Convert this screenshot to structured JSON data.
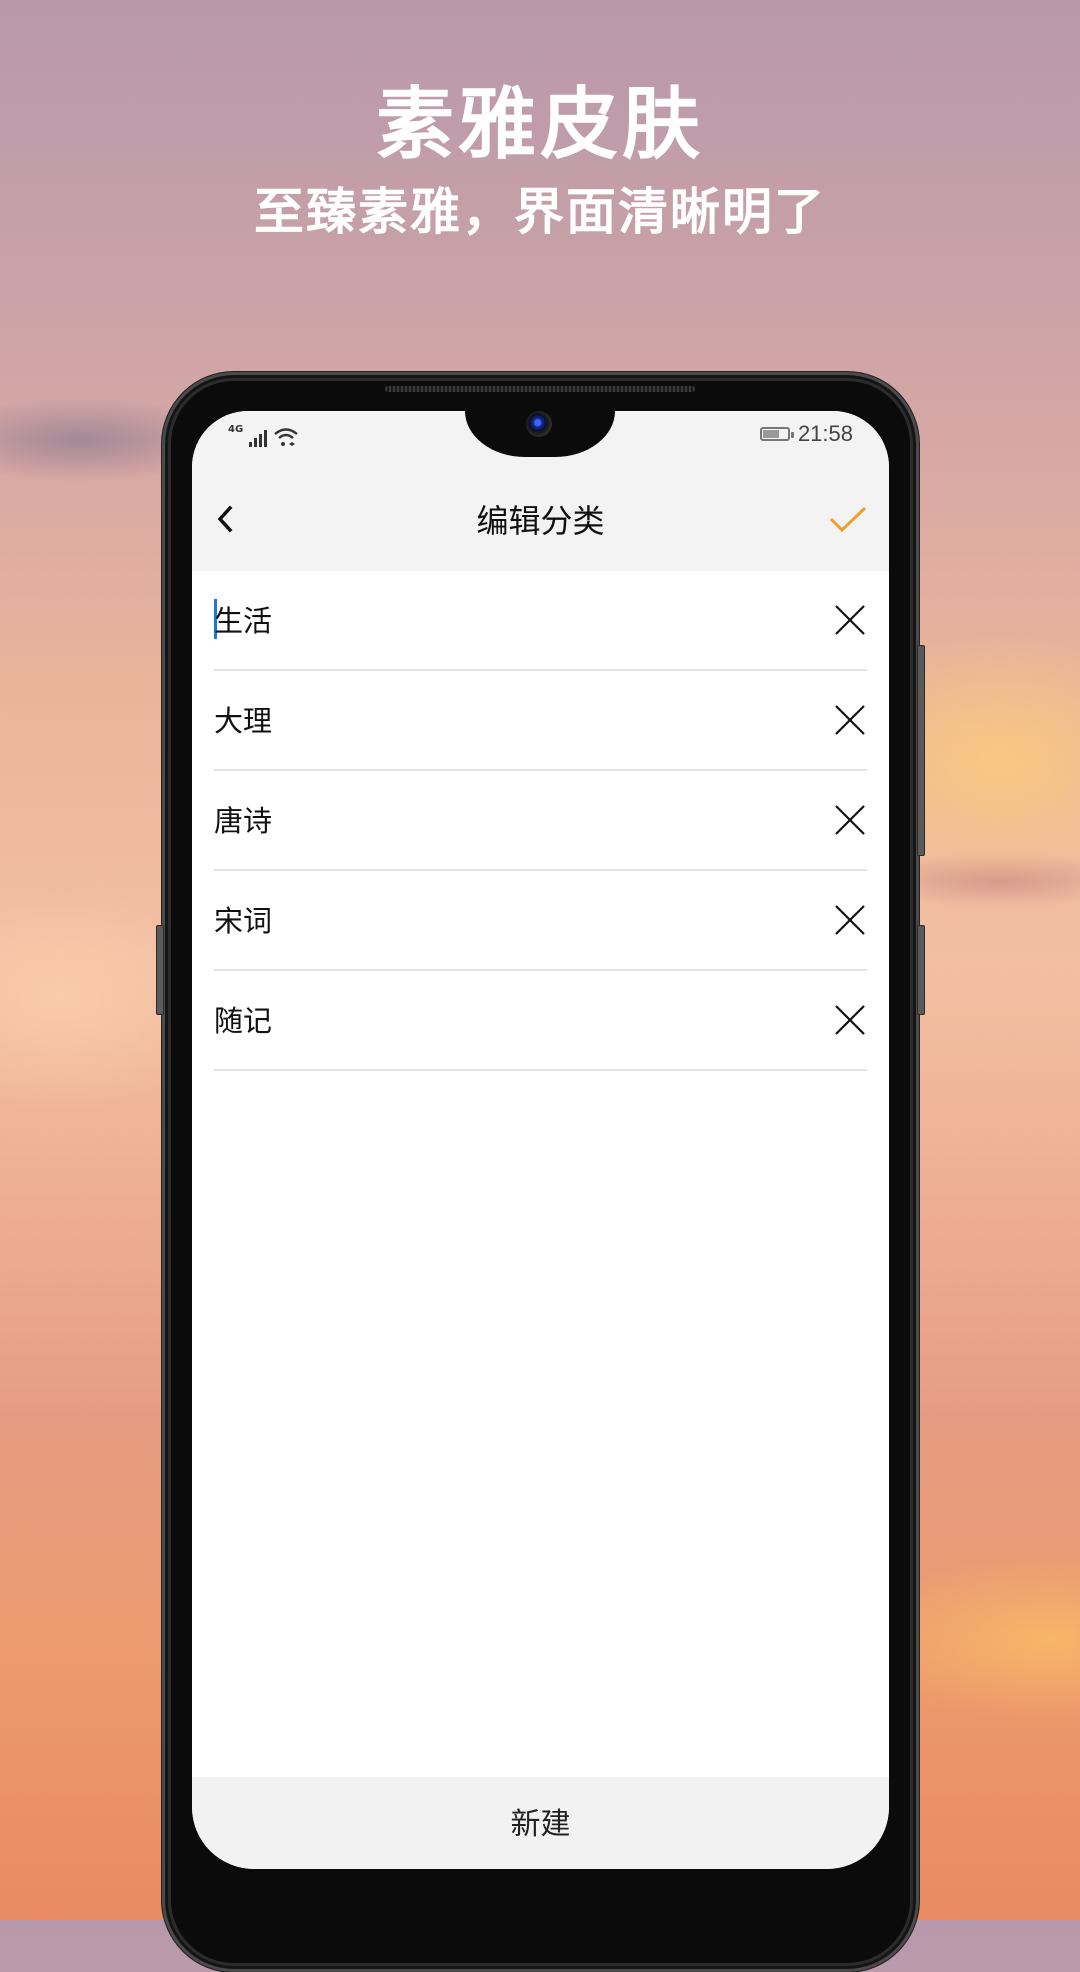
{
  "promo": {
    "title": "素雅皮肤",
    "subtitle": "至臻素雅，界面清晰明了"
  },
  "status_bar": {
    "network_label": "4G",
    "signal_icon": "signal-bars-icon",
    "wifi_icon": "wifi-icon",
    "battery_icon": "battery-charging-icon",
    "time": "21:58"
  },
  "nav": {
    "back_icon": "chevron-left-icon",
    "title": "编辑分类",
    "confirm_icon": "checkmark-icon",
    "accent_color": "#F0A030"
  },
  "categories": [
    {
      "value": "生活",
      "focused": true
    },
    {
      "value": "大理",
      "focused": false
    },
    {
      "value": "唐诗",
      "focused": false
    },
    {
      "value": "宋词",
      "focused": false
    },
    {
      "value": "随记",
      "focused": false
    }
  ],
  "delete_icon": "close-x-icon",
  "footer": {
    "new_label": "新建"
  }
}
